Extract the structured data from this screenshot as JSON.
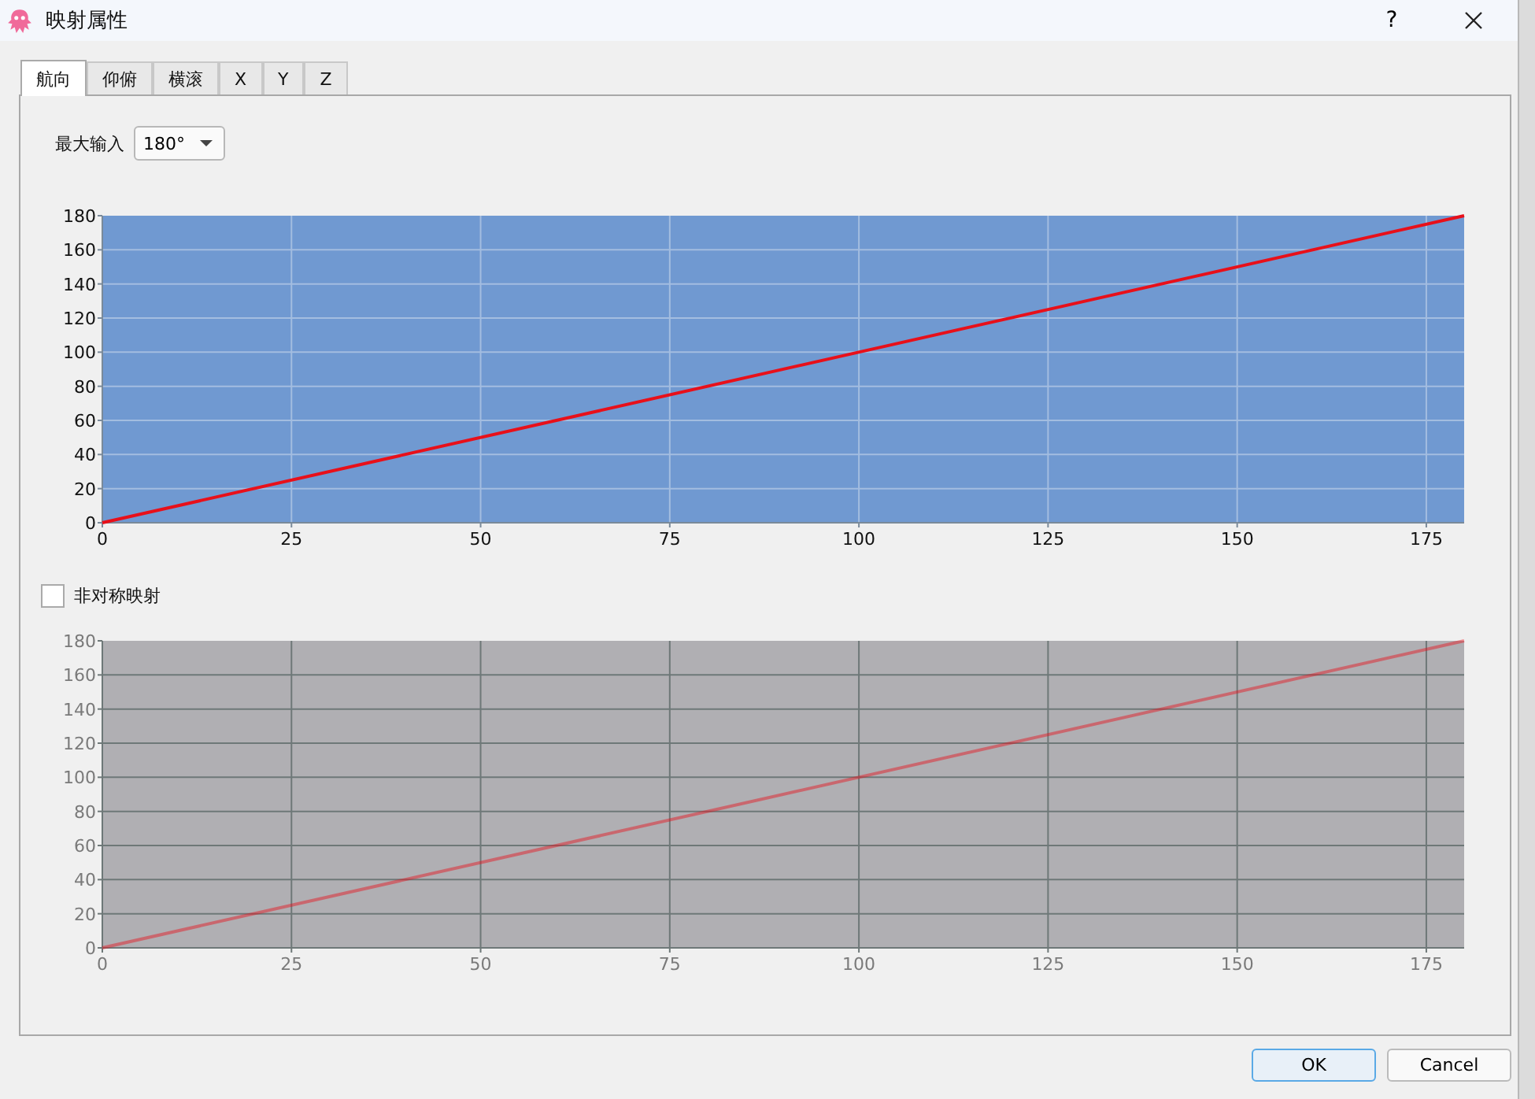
{
  "window": {
    "title": "映射属性",
    "help": "?"
  },
  "tabs": [
    {
      "label": "航向",
      "selected": true
    },
    {
      "label": "仰俯",
      "selected": false
    },
    {
      "label": "横滚",
      "selected": false
    },
    {
      "label": "X",
      "selected": false
    },
    {
      "label": "Y",
      "selected": false
    },
    {
      "label": "Z",
      "selected": false
    }
  ],
  "max_input": {
    "label": "最大输入",
    "value": "180°"
  },
  "mapping_chart": {
    "enabled": true,
    "chart_data": {
      "type": "line",
      "grid": true,
      "xlim": [
        0,
        180
      ],
      "ylim": [
        0,
        180
      ],
      "xticks": [
        0,
        25,
        50,
        75,
        100,
        125,
        150,
        175
      ],
      "yticks": [
        0,
        20,
        40,
        60,
        80,
        100,
        120,
        140,
        160,
        180
      ],
      "series": [
        {
          "color": "#e8101a",
          "x": [
            0,
            180
          ],
          "values": [
            0,
            180
          ]
        }
      ]
    }
  },
  "asymmetric": {
    "label": "非对称映射",
    "checked": false
  },
  "negative_chart": {
    "enabled": false,
    "chart_data": {
      "type": "line",
      "grid": true,
      "xlim": [
        0,
        180
      ],
      "ylim": [
        0,
        180
      ],
      "xticks": [
        0,
        25,
        50,
        75,
        100,
        125,
        150,
        175
      ],
      "yticks": [
        0,
        20,
        40,
        60,
        80,
        100,
        120,
        140,
        160,
        180
      ],
      "series": [
        {
          "color": "#e8101a",
          "x": [
            0,
            180
          ],
          "values": [
            0,
            180
          ]
        }
      ]
    }
  },
  "buttons": [
    {
      "label": "OK",
      "default": true
    },
    {
      "label": "Cancel",
      "default": false
    }
  ]
}
